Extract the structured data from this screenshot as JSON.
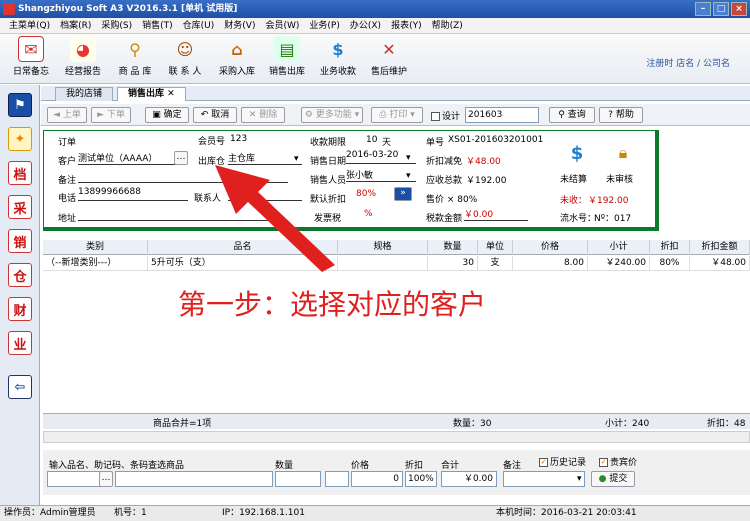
{
  "window": {
    "title": "Shangzhiyou Soft A3 V2016.3.1 [单机 试用版]"
  },
  "menu": [
    "主菜单(Q)",
    "档案(R)",
    "采购(S)",
    "销售(T)",
    "仓库(U)",
    "财务(V)",
    "会员(W)",
    "业务(P)",
    "办公(X)",
    "报表(Y)",
    "帮助(Z)"
  ],
  "toolbar": {
    "items": [
      "日常备忘",
      "经营报告",
      "商 品 库",
      "联 系 人",
      "采购入库",
      "销售出库",
      "业务收款",
      "售后维护"
    ],
    "login_info": "注册时 店名 / 公司名"
  },
  "leftbar": [
    "档",
    "采",
    "销",
    "仓",
    "财",
    "业"
  ],
  "tabs": [
    "我的店铺",
    "销售出库"
  ],
  "actions": {
    "prev": "上单",
    "next": "下单",
    "confirm": "确定",
    "cancel": "取消",
    "delete": "删除",
    "more": "更多功能",
    "print": "打印",
    "design": "设计",
    "period": "201603",
    "query": "查询",
    "help": "帮助"
  },
  "form": {
    "order_label": "订单",
    "customer_label": "客户",
    "customer_value": "测试单位（AAAA）",
    "note_label": "备注",
    "phone_label": "电话",
    "phone_value": "13899966688",
    "address_label": "地址",
    "member_label": "会员号",
    "member_value": "123",
    "warehouse_label": "出库仓",
    "warehouse_value": "主仓库",
    "contact_label": "联系人",
    "term_label": "收款期限",
    "term_value": "10",
    "term_unit": "天",
    "date_label": "销售日期",
    "date_value": "2016-03-20",
    "sales_label": "销售人员",
    "sales_value": "张小敏",
    "discount_label": "默认折扣",
    "discount_value": "80%",
    "tax_label": "发票税",
    "tax_value": "%",
    "docno_label": "单号",
    "docno_value": "XS01-201603201001",
    "rebate_label": "折扣减免",
    "rebate_value": "￥48.00",
    "receivable_label": "应收总款",
    "receivable_value": "￥192.00",
    "price_label": "售价 × 80%",
    "taxamt_label": "税款金额",
    "taxamt_value": "￥0.00",
    "unsettled": "未结算",
    "unchecked": "未审核",
    "uncollected_label": "未收：",
    "uncollected_value": "￥192.00",
    "serial_label": "流水号：",
    "serial_value": "Nº：017"
  },
  "grid": {
    "headers": [
      "类别",
      "品名",
      "规格",
      "数量",
      "单位",
      "价格",
      "小计",
      "折扣",
      "折扣金额"
    ],
    "rows": [
      [
        "（--新增类别---）",
        "5升可乐（支）",
        "",
        "30",
        "支",
        "8.00",
        "￥240.00",
        "80%",
        "￥48.00"
      ]
    ],
    "summary": {
      "items": "商品合并=1项",
      "qty": "数量：30",
      "subtotal": "小计：240",
      "discount": "折扣：48"
    }
  },
  "annotation": "第一步：选择对应的客户",
  "entry": {
    "name_label": "输入品名、助记码、条码查选商品",
    "qty_label": "数量",
    "price_label": "价格",
    "discount_label": "折扣",
    "total_label": "合计",
    "note_label": "备注",
    "qty_value": "",
    "price_value": "0",
    "discount_value": "100%",
    "total_value": "￥0.00",
    "history": "历史记录",
    "vip": "贵宾价",
    "submit": "提交"
  },
  "status": {
    "operator": "操作员：Admin管理员",
    "machine": "机号：1",
    "ip": "IP：192.168.1.101",
    "time": "本机时间：2016-03-21 20:03:41"
  },
  "colors": {
    "accent": "#0a7a2a",
    "annotation": "#e0201e",
    "title": "#1e4fa3"
  }
}
